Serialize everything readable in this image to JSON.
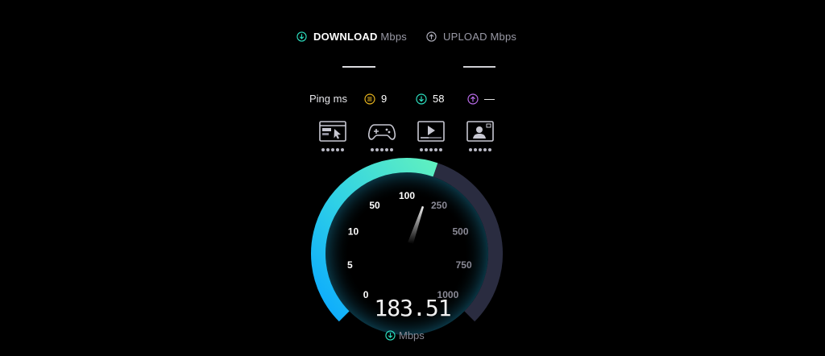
{
  "tabs": {
    "download": {
      "name": "DOWNLOAD",
      "unit": "Mbps"
    },
    "upload": {
      "name": "UPLOAD",
      "unit": "Mbps"
    }
  },
  "ping": {
    "label": "Ping ms",
    "jitter": "9",
    "download": "58",
    "upload": "—"
  },
  "experience_icons": [
    "browsing-icon",
    "gaming-icon",
    "video-streaming-icon",
    "video-call-icon"
  ],
  "gauge": {
    "ticks": [
      "0",
      "5",
      "10",
      "50",
      "100",
      "250",
      "500",
      "750",
      "1000"
    ],
    "value": "183.51",
    "unit": "Mbps"
  },
  "colors": {
    "accent_teal": "#2de0c0",
    "accent_blue": "#1aa8f0",
    "jitter_yellow": "#e8b51e",
    "upload_purple": "#b86be8",
    "gauge_track": "#2a2c40"
  }
}
